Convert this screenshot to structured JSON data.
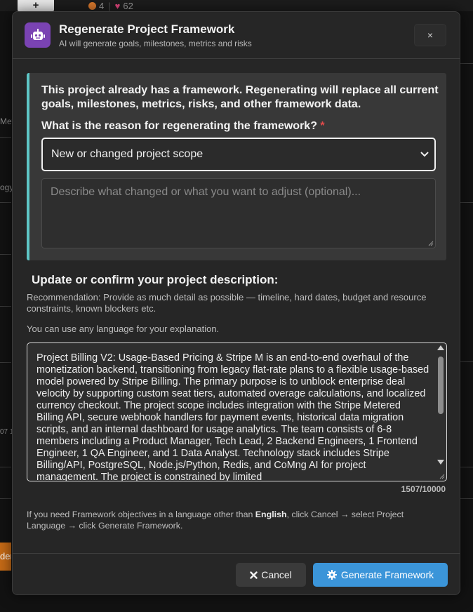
{
  "background": {
    "plus_label": "+",
    "stat_streak": "4",
    "stat_likes": "62",
    "fragments": [
      "Met",
      "ogy",
      "07 1",
      "der"
    ]
  },
  "modal": {
    "title": "Regenerate Project Framework",
    "subtitle": "AI will generate goals, milestones, metrics and risks",
    "close_label": "×",
    "robot_icon": "robot-icon",
    "warning": {
      "text": "This project already has a framework. Regenerating will replace all current goals, milestones, metrics, risks, and other framework data.",
      "reason_label": "What is the reason for regenerating the framework?",
      "required_mark": "*",
      "selected_reason": "New or changed project scope",
      "details_placeholder": "Describe what changed or what you want to adjust (optional)..."
    },
    "description_section": {
      "title": "Update or confirm your project description:",
      "recommendation": "Recommendation: Provide as much detail as possible — timeline, hard dates, budget and resource constraints, known blockers etc.",
      "language_note": "You can use any language for your explanation.",
      "description_text": "Project Billing V2: Usage-Based Pricing & Stripe M is an end-to-end overhaul of the monetization backend, transitioning from legacy flat-rate plans to a flexible usage-based model powered by Stripe Billing. The primary purpose is to unblock enterprise deal velocity by supporting custom seat tiers, automated overage calculations, and localized currency checkout. The project scope includes integration with the Stripe Metered Billing API, secure webhook handlers for payment events, historical data migration scripts, and an internal dashboard for usage analytics. The team consists of 6-8 members including a Product Manager, Tech Lead, 2 Backend Engineers, 1 Frontend Engineer, 1 QA Engineer, and 1 Data Analyst. Technology stack includes Stripe Billing/API, PostgreSQL, Node.js/Python, Redis, and CoMng AI for project management. The project is constrained by limited",
      "char_count": "1507/10000"
    },
    "footnote": {
      "prefix": "If you need Framework objectives in a language other than ",
      "language": "English",
      "suffix": ", click Cancel → select Project Language → click Generate Framework."
    },
    "buttons": {
      "cancel_label": "Cancel",
      "generate_label": "Generate Framework"
    }
  },
  "colors": {
    "accent_primary": "#3b95d9",
    "warning_border": "#5ec6c6",
    "robot_bg": "#7a43b3",
    "required": "#e34b4b"
  }
}
